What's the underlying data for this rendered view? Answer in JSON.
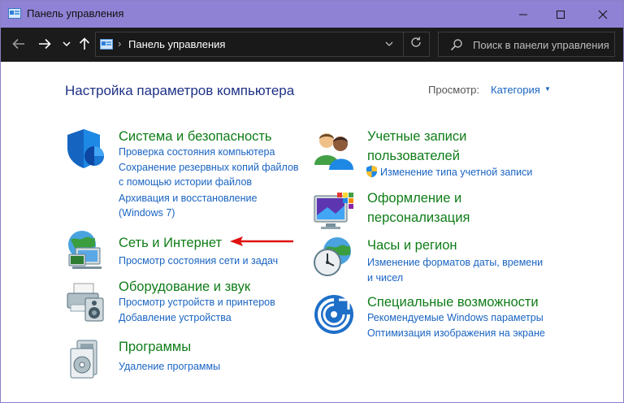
{
  "window": {
    "title": "Панель управления"
  },
  "navbar": {
    "address": "Панель управления",
    "search_placeholder": "Поиск в панели управления"
  },
  "content": {
    "page_title": "Настройка параметров компьютера",
    "view_label": "Просмотр:",
    "view_value": "Категория"
  },
  "categories": {
    "system": {
      "title": "Система и безопасность",
      "links": [
        "Проверка состояния компьютера",
        "Сохранение резервных копий файлов",
        "с помощью истории файлов",
        "Архивация и восстановление",
        "(Windows 7)"
      ]
    },
    "network": {
      "title": "Сеть и Интернет",
      "links": [
        "Просмотр состояния сети и задач"
      ]
    },
    "hardware": {
      "title": "Оборудование и звук",
      "links": [
        "Просмотр устройств и принтеров",
        "Добавление устройства"
      ]
    },
    "programs": {
      "title": "Программы",
      "links": [
        "Удаление программы"
      ]
    },
    "accounts": {
      "title_line1": "Учетные записи",
      "title_line2": "пользователей",
      "links": [
        "Изменение типа учетной записи"
      ]
    },
    "appearance": {
      "title_line1": "Оформление и",
      "title_line2": "персонализация",
      "links": []
    },
    "clock": {
      "title": "Часы и регион",
      "links": [
        "Изменение форматов даты, времени",
        "и чисел"
      ]
    },
    "access": {
      "title": "Специальные возможности",
      "links": [
        "Рекомендуемые Windows параметры",
        "Оптимизация изображения на экране"
      ]
    }
  },
  "colors": {
    "titlebar": "#8f82d4",
    "navbar": "#1b1b1b",
    "category_heading": "#0f7d18",
    "link": "#1a64c2",
    "page_title": "#1e3287",
    "arrow": "#e01010"
  }
}
